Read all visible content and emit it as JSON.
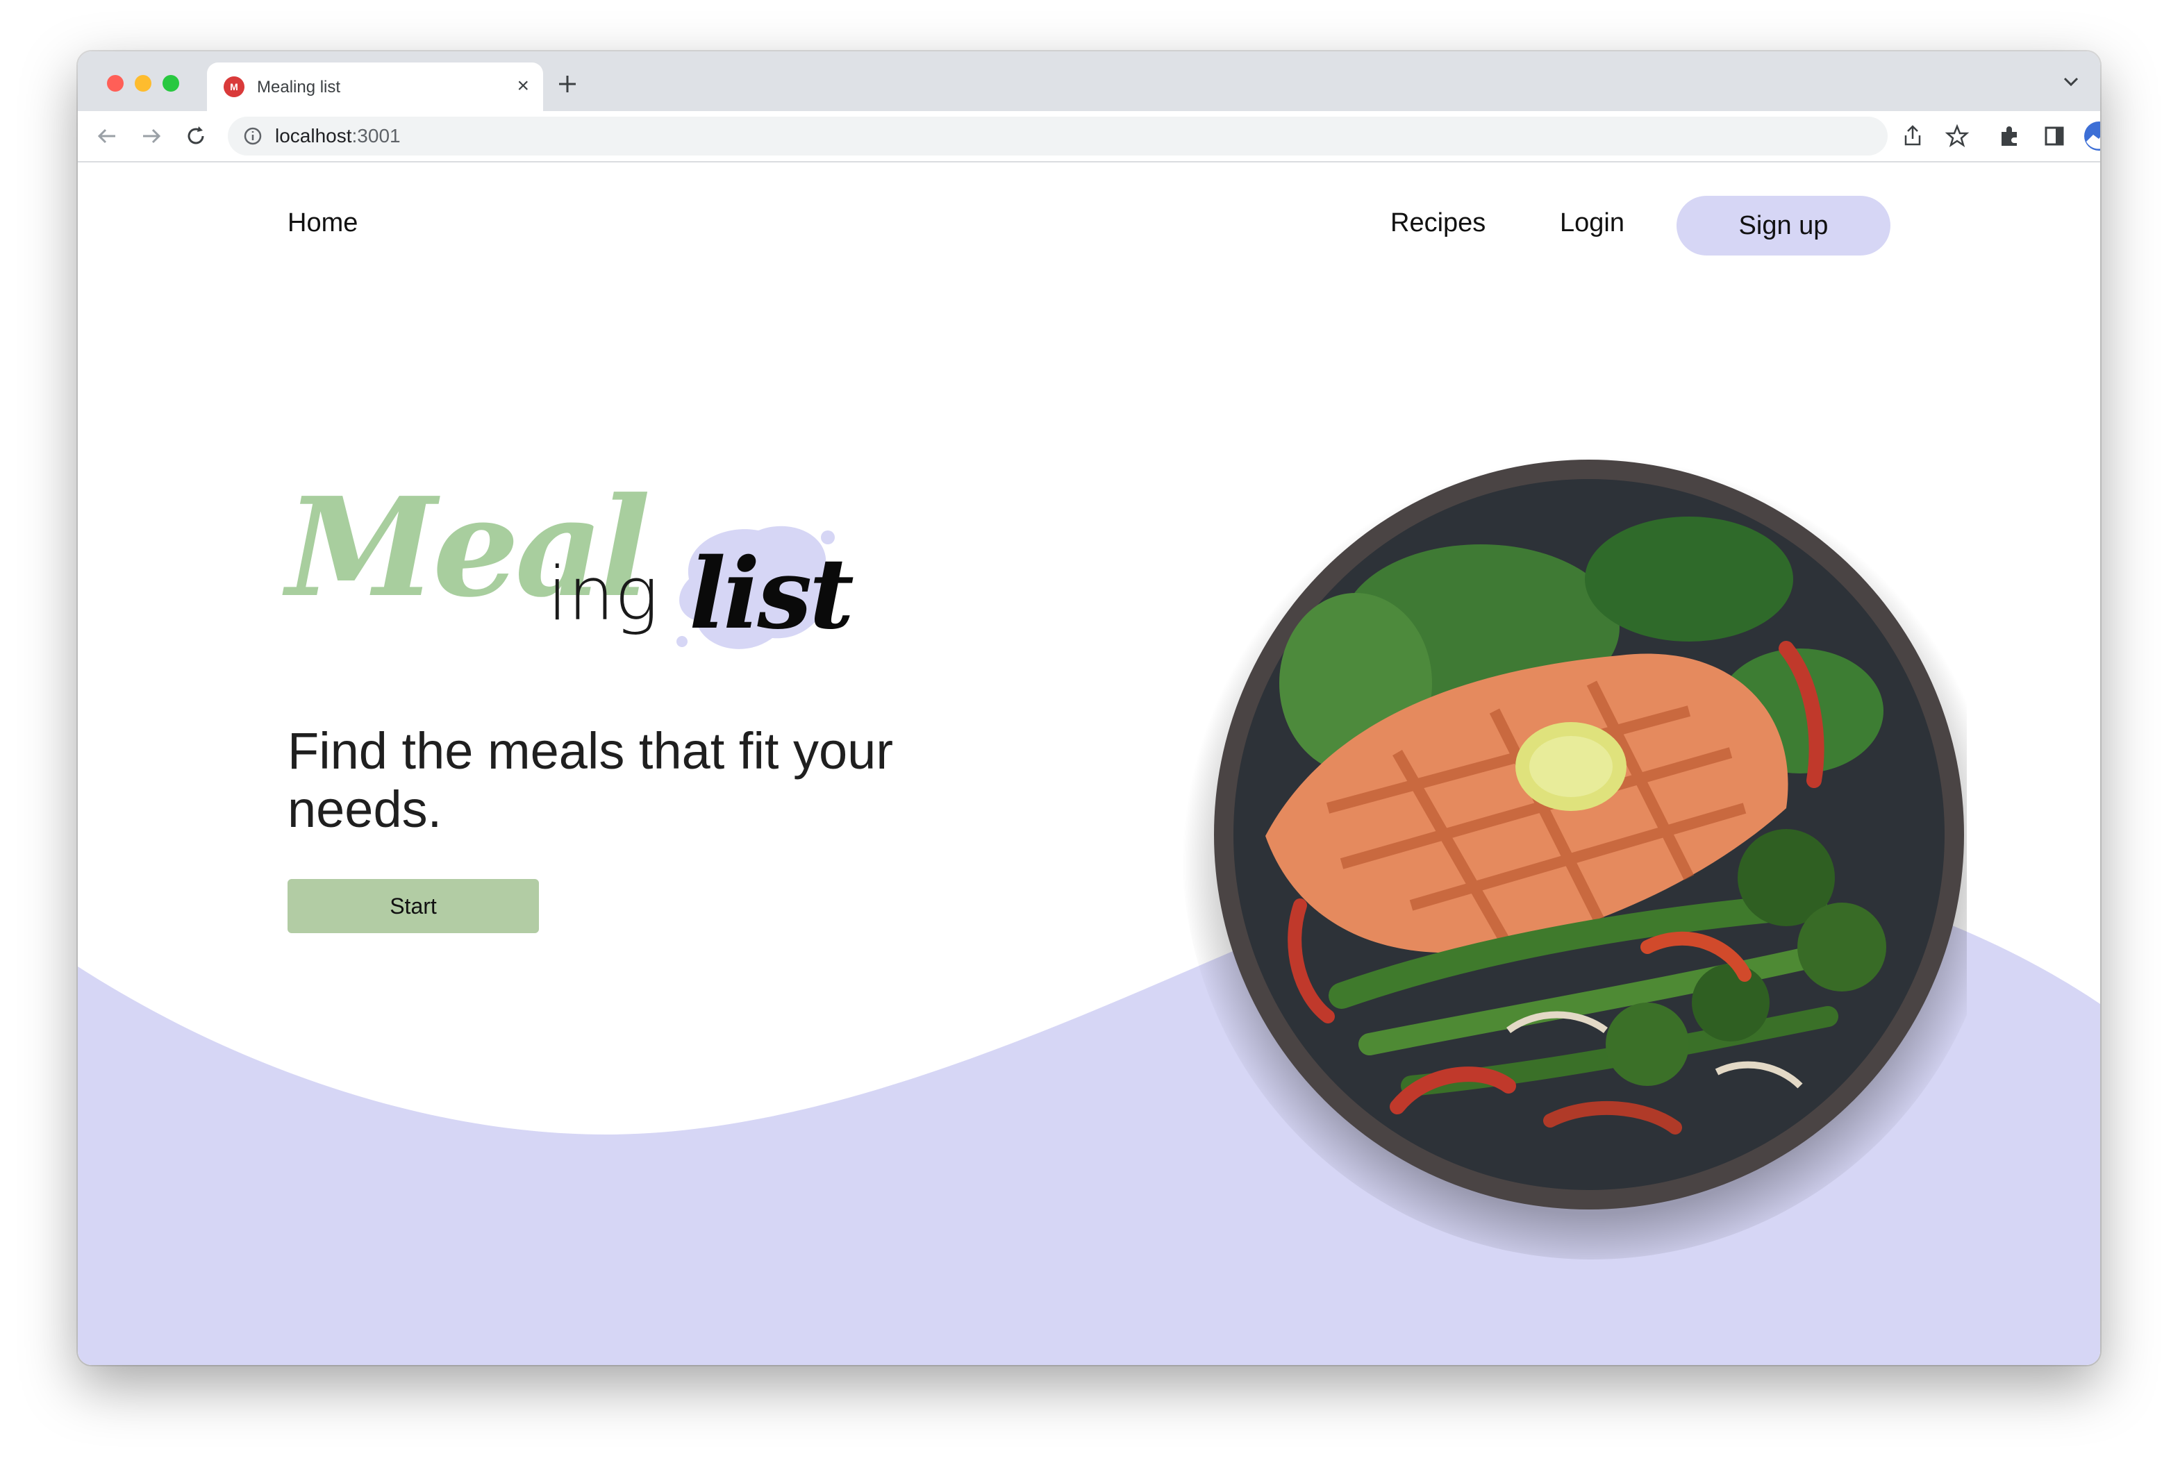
{
  "browser": {
    "tab": {
      "title": "Mealing list",
      "favicon_text": "M"
    },
    "new_tab_icon": "plus-icon",
    "address": {
      "host": "localhost",
      "port": ":3001"
    },
    "toolbar_icons": [
      "back-icon",
      "forward-icon",
      "reload-icon",
      "info-icon",
      "share-icon",
      "star-icon",
      "extensions-icon",
      "side-panel-icon",
      "profile-avatar",
      "more-icon"
    ]
  },
  "nav": {
    "home": "Home",
    "recipes": "Recipes",
    "login": "Login",
    "signup": "Sign up"
  },
  "hero": {
    "logo_meal": "Meal",
    "logo_ing": "ing",
    "logo_list": "list",
    "headline": "Find the meals that fit your needs.",
    "start_button": "Start"
  },
  "colors": {
    "accent_lavender": "#d6d6f5",
    "accent_green": "#a8ce9e",
    "button_green": "#b2cca4"
  }
}
